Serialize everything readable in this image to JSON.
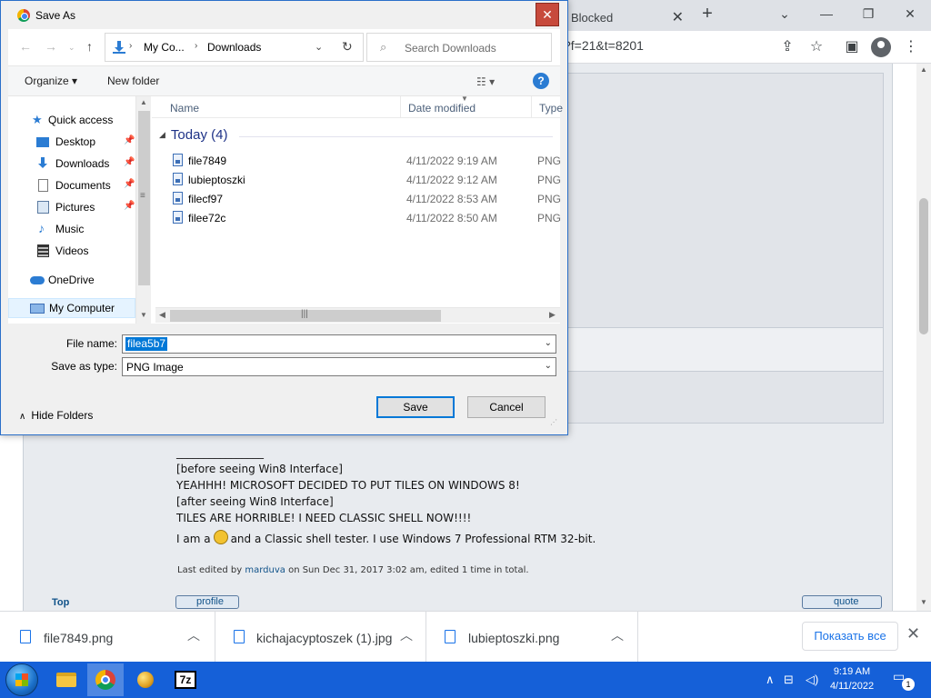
{
  "browser": {
    "tab_title": "Blocked",
    "url_tail": "?f=21&t=8201",
    "newtab_label": "+",
    "tab_close": "✕",
    "min": "⌄",
    "restore": "—",
    "maximize": "❐",
    "close": "✕"
  },
  "page": {
    "signature": {
      "rule": "________________",
      "line1": "[before seeing Win8 Interface]",
      "line2": "YEAHHH! MICROSOFT DECIDED TO PUT TILES ON WINDOWS 8!",
      "line3": "[after seeing Win8 Interface]",
      "line4": "TILES ARE HORRIBLE! I NEED CLASSIC SHELL NOW!!!!",
      "line5_a": "I am a",
      "line5_b": "and a Classic shell tester. I use Windows 7 Professional RTM 32-bit."
    },
    "edited_prefix": "Last edited by",
    "edited_user": "marduva",
    "edited_suffix": "on Sun Dec 31, 2017 3:02 am, edited 1 time in total.",
    "top_link": "Top",
    "profile_label": "profile",
    "quote_label": "quote"
  },
  "downloads": {
    "items": [
      {
        "name": "file7849.png"
      },
      {
        "name": "kichajacyptoszek (1).jpg"
      },
      {
        "name": "lubieptoszki.png"
      }
    ],
    "show_all": "Показать все",
    "close": "✕"
  },
  "taskbar": {
    "time": "9:19 AM",
    "date": "4/11/2022",
    "app_7z": "7z",
    "notif_count": "1"
  },
  "dialog": {
    "title": "Save As",
    "close": "✕",
    "breadcrumb": [
      "My Co...",
      "Downloads"
    ],
    "search_placeholder": "Search Downloads",
    "organize_label": "Organize ▾",
    "new_folder_label": "New folder",
    "help": "?",
    "nav": {
      "quick_access": "Quick access",
      "desktop": "Desktop",
      "downloads": "Downloads",
      "documents": "Documents",
      "pictures": "Pictures",
      "music": "Music",
      "videos": "Videos",
      "onedrive": "OneDrive",
      "my_computer": "My Computer"
    },
    "columns": {
      "name": "Name",
      "date": "Date modified",
      "type": "Type"
    },
    "group_label": "Today (4)",
    "files": [
      {
        "name": "file7849",
        "date": "4/11/2022 9:19 AM",
        "type": "PNG"
      },
      {
        "name": "lubieptoszki",
        "date": "4/11/2022 9:12 AM",
        "type": "PNG"
      },
      {
        "name": "filecf97",
        "date": "4/11/2022 8:53 AM",
        "type": "PNG"
      },
      {
        "name": "filee72c",
        "date": "4/11/2022 8:50 AM",
        "type": "PNG"
      }
    ],
    "file_name_label": "File name:",
    "file_name_value": "filea5b7",
    "save_type_label": "Save as type:",
    "save_type_value": "PNG Image",
    "hide_folders": "Hide Folders",
    "save_label": "Save",
    "cancel_label": "Cancel"
  }
}
